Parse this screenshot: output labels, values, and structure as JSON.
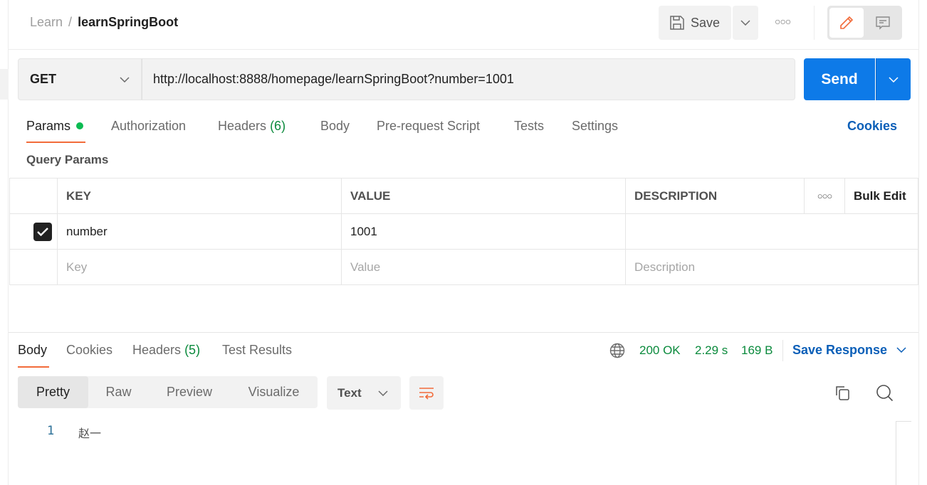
{
  "breadcrumb": {
    "parent": "Learn",
    "separator": "/",
    "current": "learnSpringBoot"
  },
  "header": {
    "save_label": "Save",
    "more_icon": "more-horizontal-icon"
  },
  "request": {
    "method": "GET",
    "url": "http://localhost:8888/homepage/learnSpringBoot?number=1001",
    "send_label": "Send"
  },
  "tabs": {
    "params": "Params",
    "authorization": "Authorization",
    "headers": "Headers",
    "headers_count": "(6)",
    "body": "Body",
    "prerequest": "Pre-request Script",
    "tests": "Tests",
    "settings": "Settings",
    "cookies": "Cookies"
  },
  "query_params": {
    "title": "Query Params",
    "columns": {
      "key": "KEY",
      "value": "VALUE",
      "description": "DESCRIPTION",
      "bulk_edit": "Bulk Edit"
    },
    "rows": [
      {
        "checked": true,
        "key": "number",
        "value": "1001",
        "description": ""
      }
    ],
    "placeholders": {
      "key": "Key",
      "value": "Value",
      "description": "Description"
    }
  },
  "response": {
    "tabs": {
      "body": "Body",
      "cookies": "Cookies",
      "headers": "Headers",
      "headers_count": "(5)",
      "test_results": "Test Results"
    },
    "status": "200 OK",
    "time": "2.29 s",
    "size": "169 B",
    "save_response": "Save Response",
    "view_modes": [
      "Pretty",
      "Raw",
      "Preview",
      "Visualize"
    ],
    "format": "Text",
    "lines": [
      {
        "number": "1",
        "text": "赵一"
      }
    ]
  },
  "colors": {
    "accent": "#f26b3a",
    "send": "#0d7ae8",
    "status_green": "#0a8a3c",
    "link_blue": "#0b5fb8"
  }
}
